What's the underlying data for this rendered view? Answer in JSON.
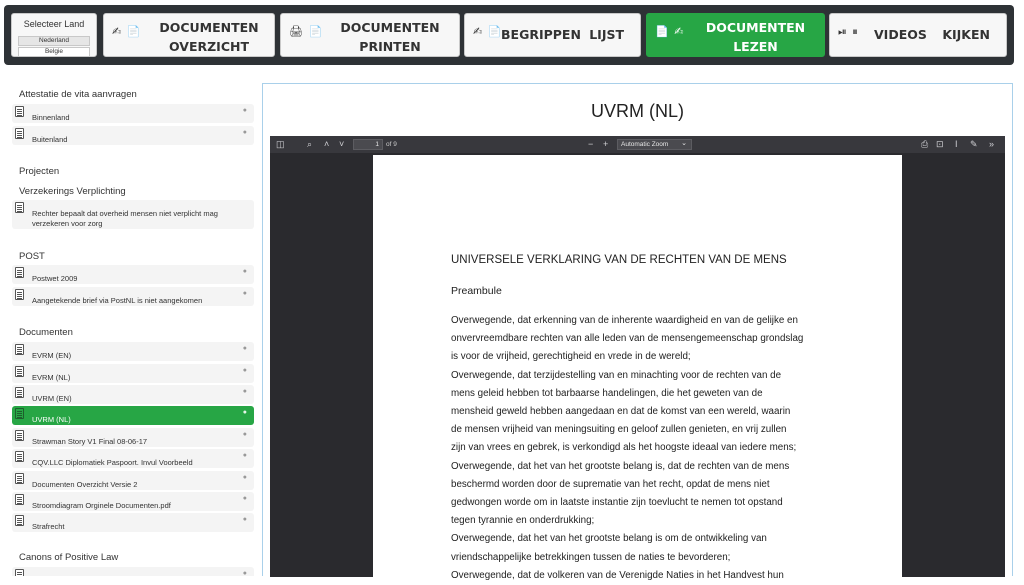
{
  "country_selector": {
    "title": "Selecteer Land",
    "options": [
      "Nederland",
      "Belgie"
    ],
    "selected": "Nederland"
  },
  "nav": {
    "overzicht": {
      "icons": "✍ 📄",
      "line1": "DOCUMENTEN",
      "line2": "OVERZICHT"
    },
    "printen": {
      "icons": "🖨 📄",
      "line1": "DOCUMENTEN",
      "line2": "PRINTEN"
    },
    "begrippen": {
      "icons": "✍ 📄",
      "word1": "BEGRIPPEN",
      "word2": "LIJST"
    },
    "lezen": {
      "icons": "📄 ✍",
      "line1": "DOCUMENTEN",
      "line2": "LEZEN",
      "active": true
    },
    "videos": {
      "icons": "⏯ ⏸",
      "word1": "VIDEOS",
      "word2": "KIJKEN"
    },
    "active_color": "#27a645"
  },
  "sidebar": {
    "sections": [
      {
        "title": "Attestatie de vita aanvragen",
        "items": [
          "Binnenland",
          "Buitenland"
        ]
      },
      {
        "title": "Projecten"
      },
      {
        "title": "Verzekerings Verplichting",
        "items": [
          "Rechter bepaalt dat overheid mensen niet verplicht mag verzekeren voor zorg"
        ]
      },
      {
        "title": "POST",
        "items": [
          "Postwet 2009",
          "Aangetekende brief via PostNL is niet aangekomen"
        ]
      },
      {
        "title": "Documenten",
        "items": [
          "EVRM (EN)",
          "EVRM (NL)",
          "UVRM (EN)",
          "UVRM (NL)",
          "Strawman Story V1 Final 08-06-17",
          "CQV.LLC Diplomatiek Paspoort. Invul Voorbeeld",
          "Documenten Overzicht Versie 2",
          "Stroomdiagram Orginele Documenten.pdf",
          "Strafrecht"
        ]
      },
      {
        "title": "Canons of Positive Law"
      }
    ],
    "selected_item": "UVRM (NL)"
  },
  "main": {
    "title": "UVRM (NL)",
    "pdf": {
      "page_number": "1",
      "page_count": "of 9",
      "zoom": "Automatic Zoom",
      "heading": "UNIVERSELE VERKLARING VAN DE RECHTEN VAN DE MENS",
      "preamble": "Preambule",
      "lines": [
        "Overwegende, dat erkenning van de inherente waardigheid en van de gelijke en",
        "onvervreemdbare rechten van alle leden van de mensengemeenschap grondslag",
        "is voor de vrijheid, gerechtigheid en vrede in de wereld;",
        "Overwegende, dat terzijdestelling van en minachting voor de rechten van de",
        "mens geleid hebben tot barbaarse handelingen, die het geweten van de",
        "mensheid geweld hebben aangedaan en dat de komst van een wereld, waarin",
        "de mensen vrijheid van meningsuiting en geloof zullen genieten, en vrij zullen",
        "zijn van vrees en gebrek, is verkondigd als het hoogste ideaal van iedere mens;",
        "Overwegende, dat het van het grootste belang is, dat de rechten van de mens",
        "beschermd worden door de suprematie van het recht, opdat de mens niet",
        "gedwongen worde om in laatste instantie zijn toevlucht te nemen tot opstand",
        "tegen tyrannie en onderdrukking;",
        "Overwegende, dat het van het grootste belang is om de ontwikkeling van",
        "vriendschappelijke betrekkingen tussen de naties te bevorderen;",
        "Overwegende, dat de volkeren van de Verenigde Naties in het Handvest hun"
      ]
    }
  }
}
